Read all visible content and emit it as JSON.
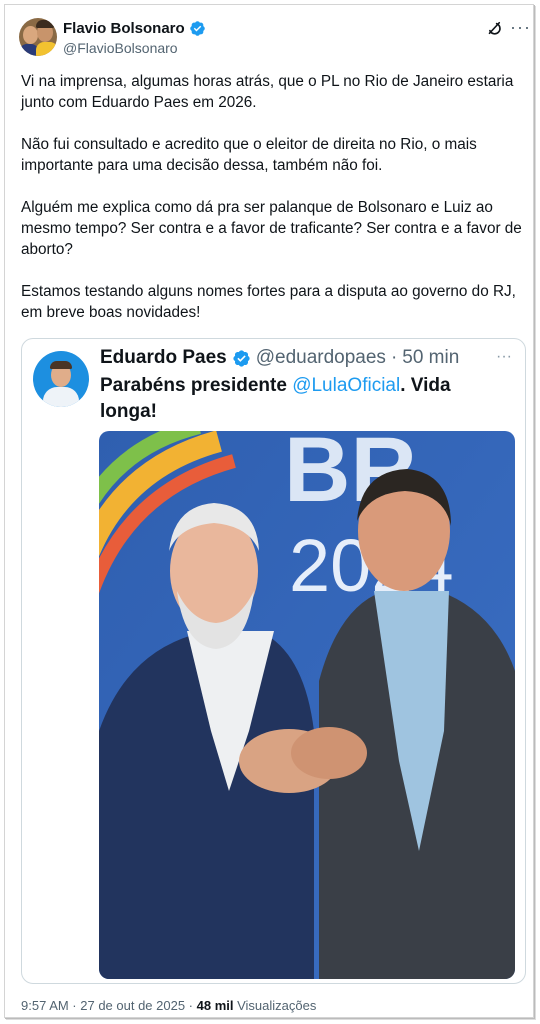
{
  "author": {
    "display_name": "Flavio Bolsonaro",
    "handle": "@FlavioBolsonaro"
  },
  "tweet": {
    "paragraphs": [
      "Vi na imprensa, algumas horas atrás, que o PL no Rio de Janeiro estaria junto com Eduardo Paes em 2026.",
      "Não fui consultado e acredito que o eleitor de direita no Rio, o mais importante para uma decisão dessa, também não foi.",
      "Alguém me explica como dá pra ser palanque de Bolsonaro e Luiz ao mesmo tempo? Ser contra e a favor de traficante? Ser contra e a favor de aborto?",
      "Estamos testando alguns nomes fortes para a disputa ao governo do RJ, em breve boas novidades!"
    ]
  },
  "quote": {
    "display_name": "Eduardo Paes",
    "handle": "@eduardopaes",
    "separator": "·",
    "time": "50 min",
    "text_before": "Parabéns presidente ",
    "mention": "@LulaOficial",
    "text_after": ".  Vida longa!",
    "photo_backdrop_text": {
      "line1": "BR",
      "line2": "2024"
    }
  },
  "footer": {
    "time_date": "9:57 AM · 27 de out de 2025 · ",
    "views_count": "48 mil",
    "views_label": " Visualizações"
  },
  "colors": {
    "verified": "#1d9bf0",
    "mention": "#1d9bf0",
    "secondary_text": "#536471",
    "border": "#cfd9de"
  },
  "icons": {
    "verified": "verified-badge-icon",
    "grok": "grok-icon",
    "more": "more-icon"
  }
}
